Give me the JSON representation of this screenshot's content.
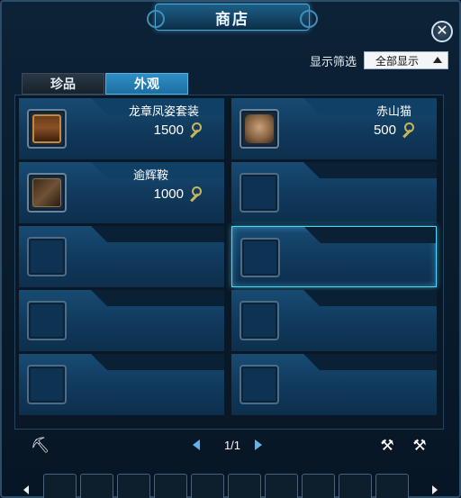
{
  "window": {
    "title": "商店"
  },
  "filter": {
    "label": "显示筛选",
    "selected": "全部显示"
  },
  "tabs": [
    {
      "label": "珍品",
      "active": false
    },
    {
      "label": "外观",
      "active": true
    }
  ],
  "items": [
    {
      "name": "龙章凤姿套装",
      "price": "1500",
      "icon": "chest-icon"
    },
    {
      "name": "赤山猫",
      "price": "500",
      "icon": "cat-icon"
    },
    {
      "name": "逾辉鞍",
      "price": "1000",
      "icon": "saddle-icon"
    }
  ],
  "pager": {
    "page": "1/1"
  },
  "colors": {
    "accent": "#4fd3ff",
    "panel": "#184b73",
    "currency": "#c9b65a"
  }
}
